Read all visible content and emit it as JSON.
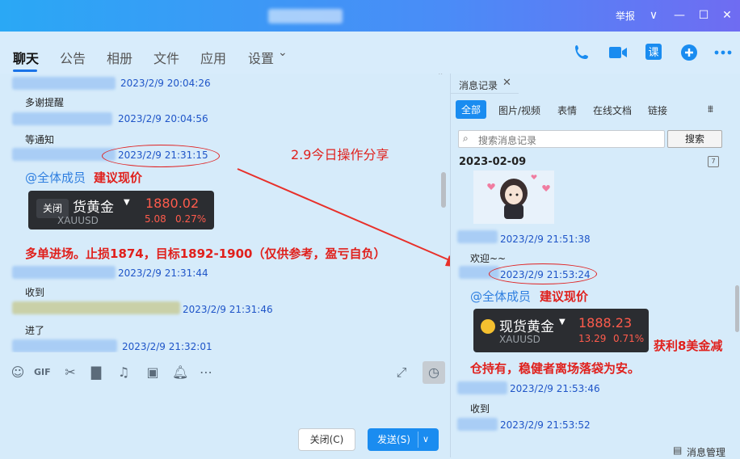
{
  "window": {
    "report": "举报",
    "min": "—",
    "max": "☐",
    "close": "✕",
    "chevron": "∨"
  },
  "tabs": [
    "聊天",
    "公告",
    "相册",
    "文件",
    "应用",
    "设置"
  ],
  "tab_settings_chevron": "⌄",
  "chat": {
    "messages": [
      {
        "ts": "2023/2/9 20:04:26",
        "text": "多谢提醒"
      },
      {
        "ts": "2023/2/9 20:04:56",
        "text": "等通知"
      },
      {
        "ts": "2023/2/9 21:31:15"
      },
      {
        "ts": "2023/2/9 21:31:44",
        "text": "收到"
      },
      {
        "ts": "2023/2/9 21:31:46",
        "text": "进了"
      },
      {
        "ts": "2023/2/9 21:32:01"
      }
    ],
    "at_all": "@全体成员",
    "suggest": "建议现价",
    "card": {
      "close": "关闭",
      "name": "货黄金",
      "code": "XAUUSD",
      "price": "1880.02",
      "change": "5.08",
      "pct": "0.27%"
    },
    "long_text": "多单进场。止损1874，目标1892-1900（仅供参考，盈亏自负）",
    "collapse_icon": "ˆ"
  },
  "annotation": "2.9今日操作分享",
  "input": {
    "close_button": "关闭(C)",
    "send_button": "发送(S)"
  },
  "history": {
    "tab": "消息记录",
    "filters": [
      "全部",
      "图片/视频",
      "表情",
      "在线文档",
      "链接"
    ],
    "search_placeholder": "搜索消息记录",
    "search_button": "搜索",
    "date": "2023-02-09",
    "messages": [
      {
        "ts": "2023/2/9 21:51:38",
        "text": "欢迎~~"
      },
      {
        "ts": "2023/2/9 21:53:24"
      },
      {
        "ts": "2023/2/9 21:53:46",
        "text": "收到"
      },
      {
        "ts": "2023/2/9 21:53:52"
      }
    ],
    "at_all": "@全体成员",
    "suggest": "建议现价",
    "card": {
      "name": "现货黄金",
      "code": "XAUUSD",
      "price": "1888.23",
      "change": "13.29",
      "pct": "0.71%"
    },
    "profit_1": "获利8美金减",
    "profit_2": "仓持有，稳健者离场落袋为安。",
    "manage": "消息管理"
  },
  "colors": {
    "accent": "#1a8cf0",
    "red": "#e0201c",
    "timestamp": "#1f55c8"
  }
}
